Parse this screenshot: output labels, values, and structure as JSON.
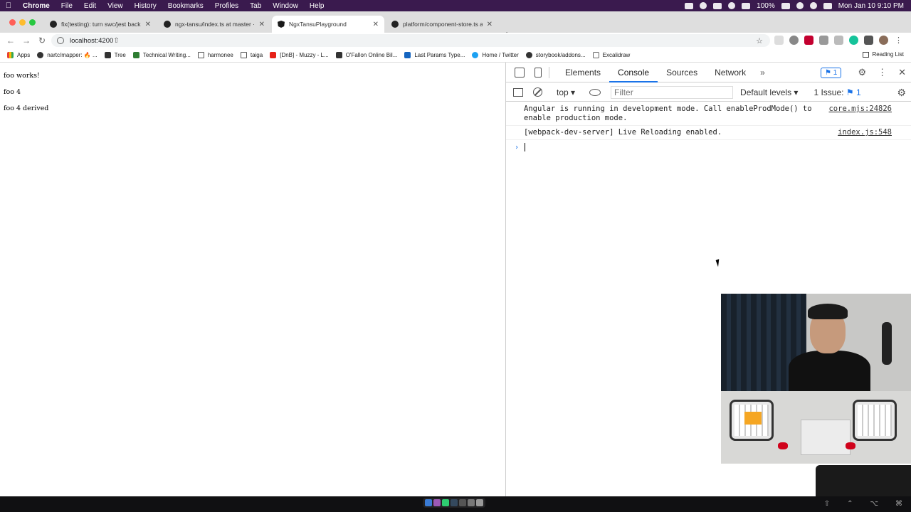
{
  "menubar": {
    "app": "Chrome",
    "items": [
      "File",
      "Edit",
      "View",
      "History",
      "Bookmarks",
      "Profiles",
      "Tab",
      "Window",
      "Help"
    ],
    "battery": "100%",
    "clock": "Mon Jan 10  9:10 PM"
  },
  "tabs": [
    {
      "title": "fix(testing): turn swc/jest back"
    },
    {
      "title": "ngx-tansu/index.ts at master ·"
    },
    {
      "title": "NgxTansuPlayground"
    },
    {
      "title": "platform/component-store.ts a"
    }
  ],
  "tab_close": "✕",
  "new_tab": "+",
  "toolbar": {
    "back": "←",
    "forward": "→",
    "reload": "↻",
    "url": "localhost:4200"
  },
  "bookmarks": [
    {
      "label": "Apps",
      "icon": "apps-icon"
    },
    {
      "label": "nartc/mapper: 🔥 ...",
      "icon": "github-icon"
    },
    {
      "label": "Tree",
      "icon": "bookmark-icon"
    },
    {
      "label": "Technical Writing...",
      "icon": "bookmark-icon"
    },
    {
      "label": "harmonee",
      "icon": "folder-icon"
    },
    {
      "label": "taiga",
      "icon": "folder-icon"
    },
    {
      "label": "[DnB] - Muzzy - L...",
      "icon": "youtube-icon"
    },
    {
      "label": "O'Fallon Online Bil...",
      "icon": "bookmark-icon"
    },
    {
      "label": "Last Params Type...",
      "icon": "bookmark-icon"
    },
    {
      "label": "Home / Twitter",
      "icon": "twitter-icon"
    },
    {
      "label": "storybook/addons...",
      "icon": "github-icon"
    },
    {
      "label": "Excalidraw",
      "icon": "bookmark-icon"
    }
  ],
  "reading_list": "Reading List",
  "page": {
    "lines": [
      "foo works!",
      "foo 4",
      "foo 4 derived"
    ]
  },
  "devtools": {
    "tabs": [
      "Elements",
      "Console",
      "Sources",
      "Network"
    ],
    "active_tab": "Console",
    "more": "»",
    "issue_count": "1",
    "context": "top ▾",
    "filter_placeholder": "Filter",
    "levels": "Default levels ▾",
    "issues_label": "1 Issue:",
    "issues_count": "1",
    "messages": [
      {
        "text": "Angular is running in development mode. Call enableProdMode() to enable production mode.",
        "source": "core.mjs:24826"
      },
      {
        "text": "[webpack-dev-server] Live Reloading enabled.",
        "source": "index.js:548"
      }
    ],
    "prompt": "›"
  },
  "colors": {
    "menubar": "#3a1a4e",
    "tabstrip": "#dedede",
    "accent": "#1a73e8"
  }
}
